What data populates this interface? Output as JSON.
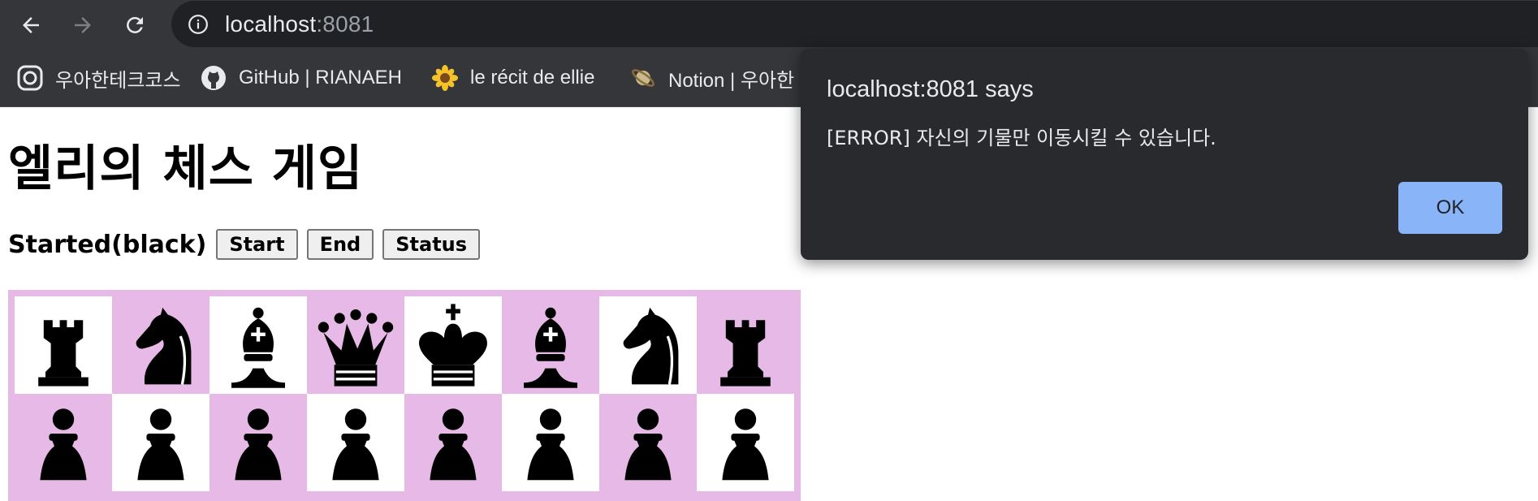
{
  "browser": {
    "url_host": "localhost",
    "url_port": ":8081",
    "bookmarks": [
      {
        "label": "우아한테크코스",
        "icon": "woowa-icon"
      },
      {
        "label": "GitHub | RIANAEH",
        "icon": "github-icon"
      },
      {
        "label": "le récit de ellie",
        "icon": "sunflower-icon"
      },
      {
        "label": "Notion | 우아한",
        "icon": "planet-icon"
      }
    ]
  },
  "page": {
    "title": "엘리의 체스 게임",
    "status": "Started(black)",
    "buttons": {
      "start": "Start",
      "end": "End",
      "status": "Status"
    }
  },
  "board": {
    "rows": [
      [
        "rook",
        "knight",
        "bishop",
        "queen",
        "king",
        "bishop",
        "knight",
        "rook"
      ],
      [
        "pawn",
        "pawn",
        "pawn",
        "pawn",
        "pawn",
        "pawn",
        "pawn",
        "pawn"
      ]
    ],
    "piece_color": "black",
    "colors": {
      "light": "#ffffff",
      "dark": "#e6b9e6"
    }
  },
  "dialog": {
    "title": "localhost:8081 says",
    "message": "[ERROR] 자신의 기물만 이동시킬 수 있습니다.",
    "ok_label": "OK"
  },
  "colors": {
    "chrome": "#35363a",
    "omnibox": "#202124",
    "dialog_bg": "#292a2d",
    "ok_button": "#8ab4f8"
  }
}
